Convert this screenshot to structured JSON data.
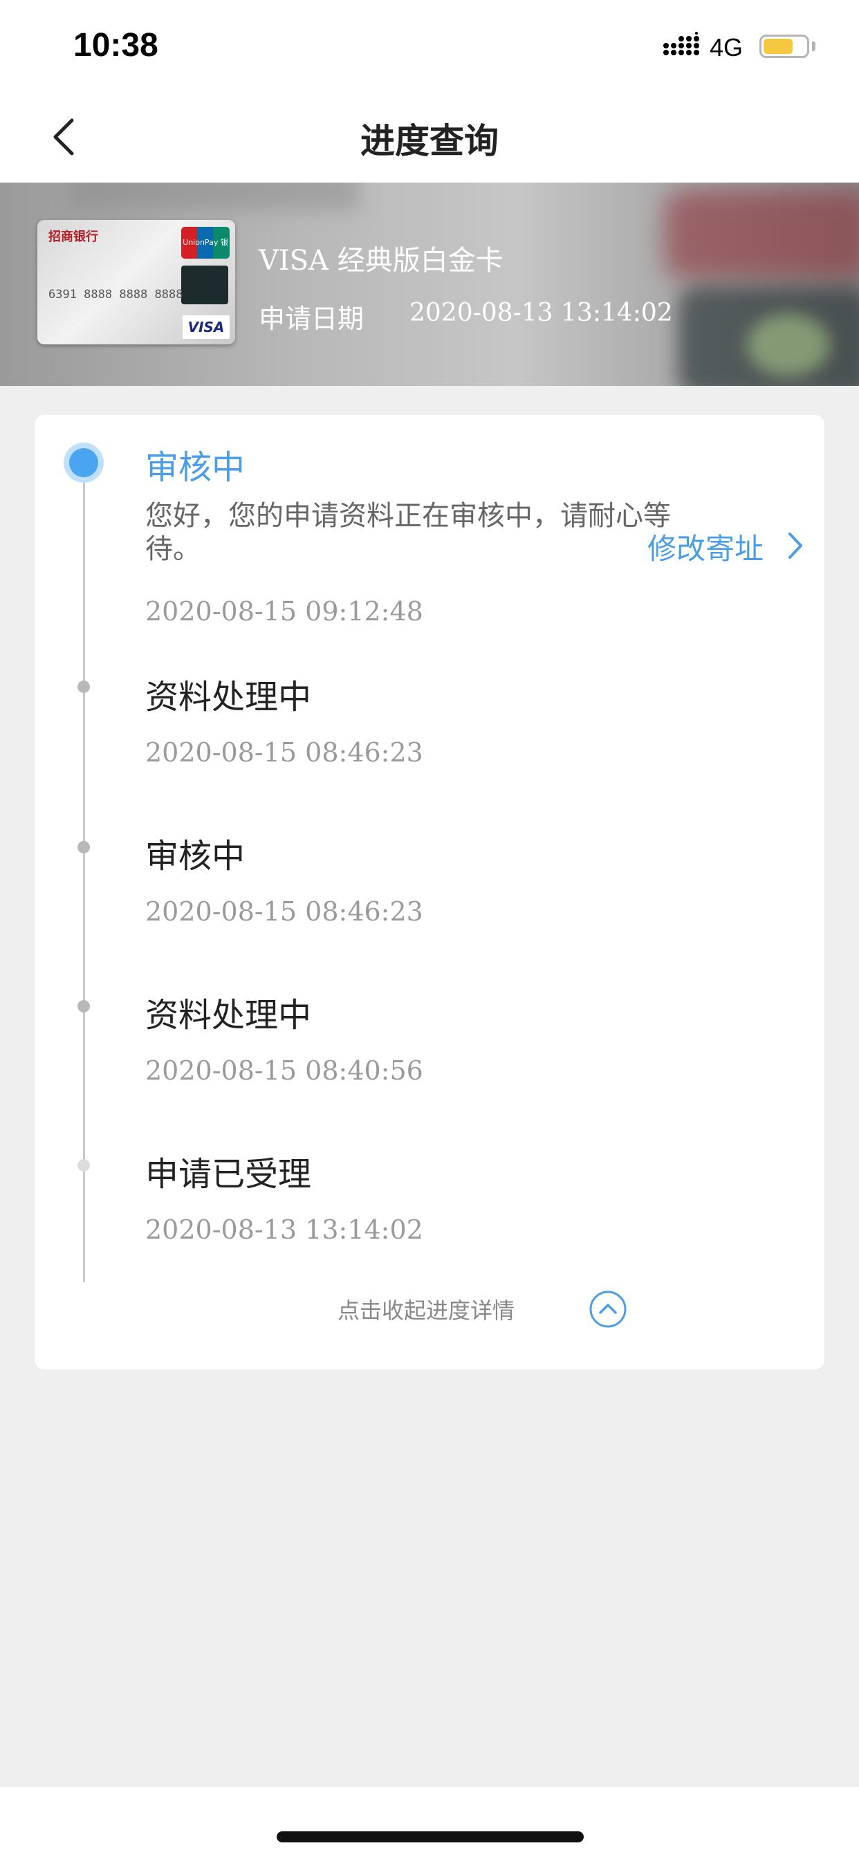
{
  "status_bar": {
    "time": "10:38",
    "network": "4G",
    "battery_color": "#f5c842"
  },
  "nav": {
    "title": "进度查询",
    "back_icon": "chevron-left-icon"
  },
  "card": {
    "thumbnail": {
      "bank_name": "招商银行",
      "union_label": "UnionPay 银联",
      "card_number": "6391 8888 8888 8888",
      "network_logo": "VISA"
    },
    "name": "VISA 经典版白金卡",
    "apply_date_label": "申请日期",
    "apply_date": "2020-08-13 13:14:02"
  },
  "timeline": {
    "accent_color": "#4a9ee8",
    "steps": [
      {
        "title": "审核中",
        "description": "您好，您的申请资料正在审核中，请耐心等待。",
        "time": "2020-08-15 09:12:48",
        "active": true
      },
      {
        "title": "资料处理中",
        "time": "2020-08-15 08:46:23",
        "active": false
      },
      {
        "title": "审核中",
        "time": "2020-08-15 08:46:23",
        "active": false
      },
      {
        "title": "资料处理中",
        "time": "2020-08-15 08:40:56",
        "active": false
      },
      {
        "title": "申请已受理",
        "time": "2020-08-13 13:14:02",
        "active": false
      }
    ],
    "edit_address_label": "修改寄址",
    "collapse_label": "点击收起进度详情"
  }
}
